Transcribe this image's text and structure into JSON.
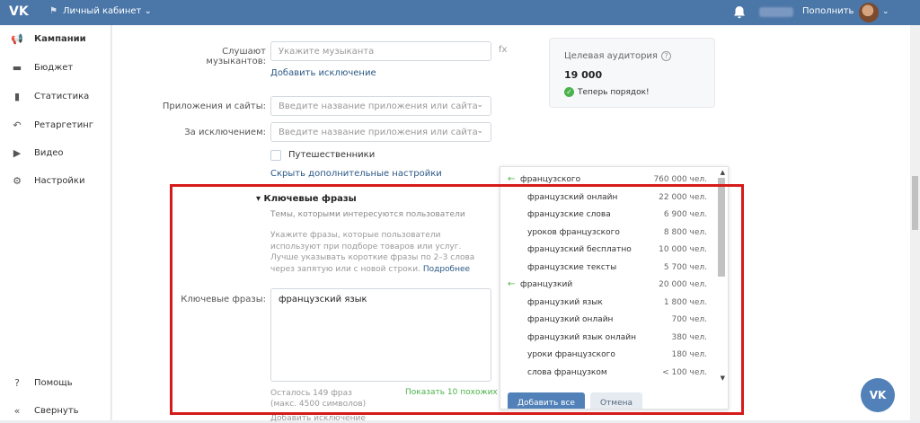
{
  "topbar": {
    "logo": "VK",
    "cabinet": "Личный кабинет",
    "topup": "Пополнить"
  },
  "sidebar": {
    "items": [
      {
        "label": "Кампании",
        "icon": "megaphone-icon"
      },
      {
        "label": "Бюджет",
        "icon": "wallet-icon"
      },
      {
        "label": "Статистика",
        "icon": "stats-icon"
      },
      {
        "label": "Ретаргетинг",
        "icon": "retarget-icon"
      },
      {
        "label": "Видео",
        "icon": "video-icon"
      },
      {
        "label": "Настройки",
        "icon": "gear-icon"
      }
    ],
    "help": "Помощь",
    "collapse": "Свернуть"
  },
  "form": {
    "music_label": "Слушают музыкантов:",
    "music_placeholder": "Укажите музыканта",
    "fx": "fx",
    "add_exclusion": "Добавить исключение",
    "apps_label": "Приложения и сайты:",
    "apps_placeholder": "Введите название приложения или сайта",
    "except_label": "За исключением:",
    "except_placeholder": "Введите название приложения или сайта",
    "travelers": "Путешественники",
    "hide_settings": "Скрыть дополнительные настройки"
  },
  "audience": {
    "title": "Целевая аудитория",
    "value": "19 000",
    "status": "Теперь порядок!"
  },
  "keywords": {
    "heading": "Ключевые фразы",
    "subtitle": "Темы, которыми интересуются пользователи",
    "desc": "Укажите фразы, которые пользователи используют при подборе товаров или услуг. Лучше указывать короткие фразы по 2–3 слова через запятую или с новой строки.",
    "more": "Подробнее",
    "label": "Ключевые фразы:",
    "value": "французский язык",
    "left1": "Осталось 149 фраз",
    "left2": "(макс. 4500 символов)",
    "show_similar": "Показать 10 похожих",
    "truncated": "Добавить исключение"
  },
  "suggestions": {
    "rows": [
      {
        "text": "французского",
        "count": "760 000 чел.",
        "parent": true
      },
      {
        "text": "французский онлайн",
        "count": "22 000 чел.",
        "parent": false
      },
      {
        "text": "французские слова",
        "count": "6 900 чел.",
        "parent": false
      },
      {
        "text": "уроков французского",
        "count": "8 800 чел.",
        "parent": false
      },
      {
        "text": "французский бесплатно",
        "count": "10 000 чел.",
        "parent": false
      },
      {
        "text": "французские тексты",
        "count": "5 700 чел.",
        "parent": false
      },
      {
        "text": "французкий",
        "count": "20 000 чел.",
        "parent": true
      },
      {
        "text": "французкий язык",
        "count": "1 800 чел.",
        "parent": false
      },
      {
        "text": "французкий онлайн",
        "count": "700 чел.",
        "parent": false
      },
      {
        "text": "французкий язык онлайн",
        "count": "380 чел.",
        "parent": false
      },
      {
        "text": "уроки французского",
        "count": "180 чел.",
        "parent": false
      },
      {
        "text": "слова французком",
        "count": "< 100 чел.",
        "parent": false
      }
    ],
    "add_all": "Добавить все",
    "cancel": "Отмена"
  },
  "colors": {
    "accent": "#4a76a8",
    "button": "#5181b8",
    "success": "#4bb34b",
    "highlight": "#d61a1a"
  }
}
